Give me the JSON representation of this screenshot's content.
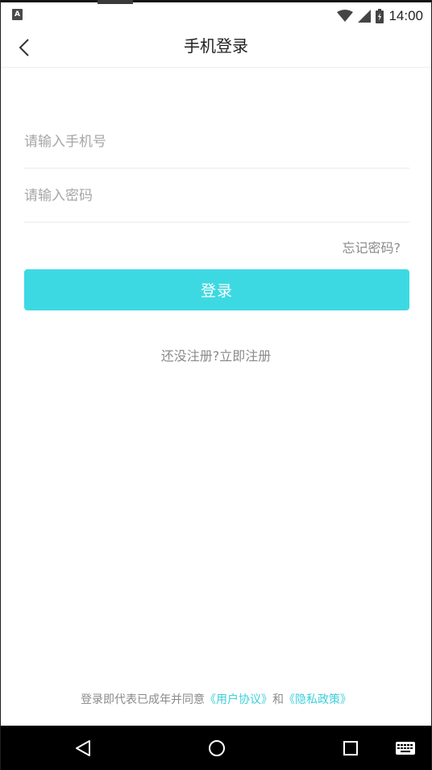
{
  "status_bar": {
    "notification_icon": "A",
    "time": "14:00",
    "icons": [
      "wifi-icon",
      "signal-icon",
      "battery-icon"
    ]
  },
  "header": {
    "title": "手机登录",
    "back_icon": "chevron-left-icon"
  },
  "form": {
    "phone_placeholder": "请输入手机号",
    "phone_value": "",
    "password_placeholder": "请输入密码",
    "password_value": "",
    "forgot_label": "忘记密码?",
    "login_label": "登录"
  },
  "register": {
    "prompt": "还没注册?",
    "link": "立即注册"
  },
  "agreement": {
    "prefix": "登录即代表已成年并同意",
    "user_agreement": "《用户协议》",
    "conjunction": "和",
    "privacy_policy": "《隐私政策》"
  },
  "colors": {
    "accent": "#3dd9e2",
    "link": "#3dcfd9",
    "text_muted": "#8a8a8a"
  },
  "nav_bar": {
    "icons": [
      "back-triangle-icon",
      "home-circle-icon",
      "recents-square-icon",
      "keyboard-icon"
    ]
  }
}
